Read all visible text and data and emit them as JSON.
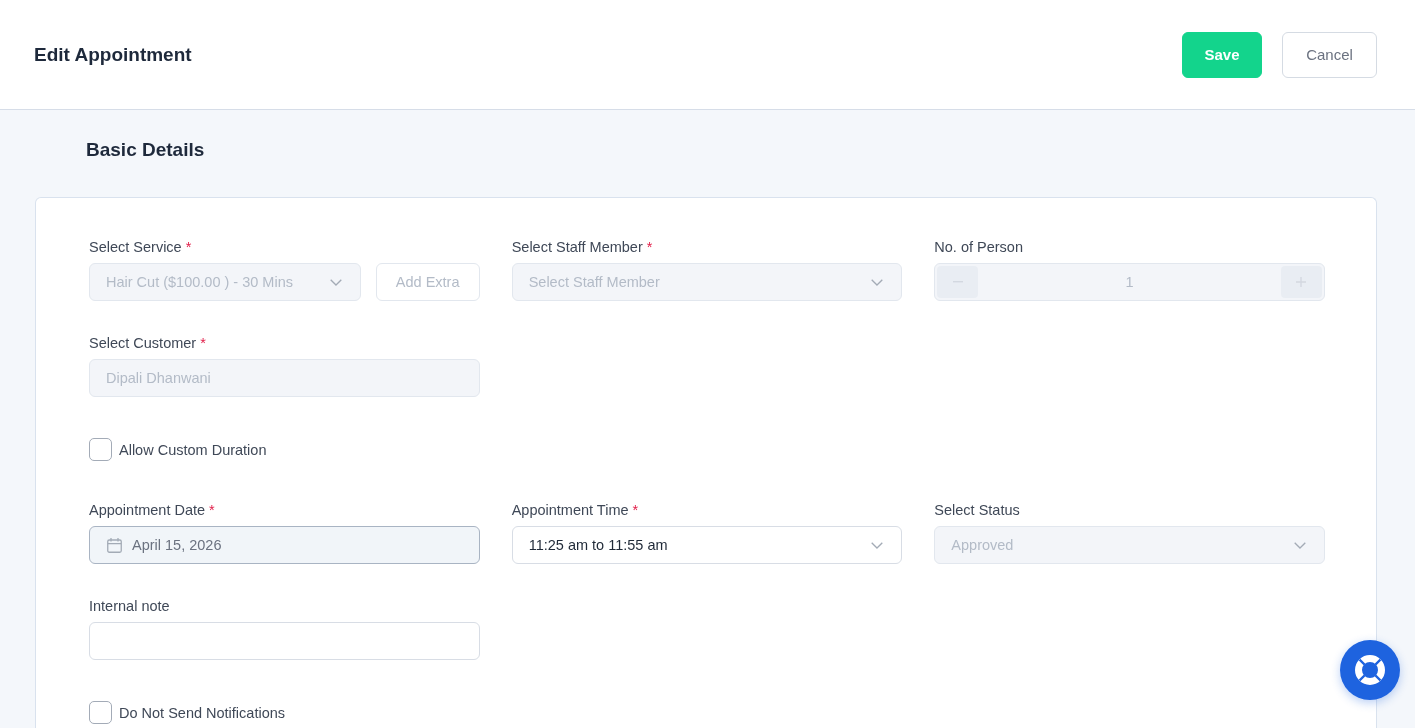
{
  "header": {
    "title": "Edit Appointment",
    "actions": [
      {
        "label": "Save",
        "kind": "primary"
      },
      {
        "label": "Cancel",
        "kind": "secondary"
      }
    ]
  },
  "section_title": "Basic Details",
  "form": {
    "blocks": [
      {
        "kind": "fields",
        "fields": [
          {
            "kind": "select",
            "label": "Select Service",
            "required_mark": "*",
            "value": "Hair Cut ($100.00 ) - 30 Mins",
            "disabled": true,
            "extra_button": {
              "label": "Add Extra",
              "disabled": true
            }
          },
          {
            "kind": "select",
            "label": "Select Staff Member",
            "required_mark": "*",
            "placeholder": "Select Staff Member",
            "disabled": true
          },
          {
            "kind": "stepper",
            "label": "No. of Person",
            "value": "1",
            "disabled": true
          }
        ]
      },
      {
        "kind": "fields",
        "fields": [
          {
            "kind": "text",
            "label": "Select Customer",
            "required_mark": "*",
            "value": "Dipali Dhanwani",
            "disabled": true
          }
        ]
      },
      {
        "kind": "checkbox",
        "label": "Allow Custom Duration",
        "checked": false
      },
      {
        "kind": "fields",
        "fields": [
          {
            "kind": "date",
            "label": "Appointment Date",
            "required_mark": "*",
            "value": "April 15, 2026",
            "disabled": false
          },
          {
            "kind": "select",
            "label": "Appointment Time",
            "required_mark": "*",
            "value": "11:25 am to 11:55 am",
            "disabled": false
          },
          {
            "kind": "select",
            "label": "Select Status",
            "value": "Approved",
            "disabled": true
          }
        ]
      },
      {
        "kind": "fields",
        "fields": [
          {
            "kind": "text",
            "label": "Internal note",
            "disabled": false
          }
        ]
      },
      {
        "kind": "checkbox",
        "label": "Do Not Send Notifications",
        "checked": false
      }
    ]
  }
}
